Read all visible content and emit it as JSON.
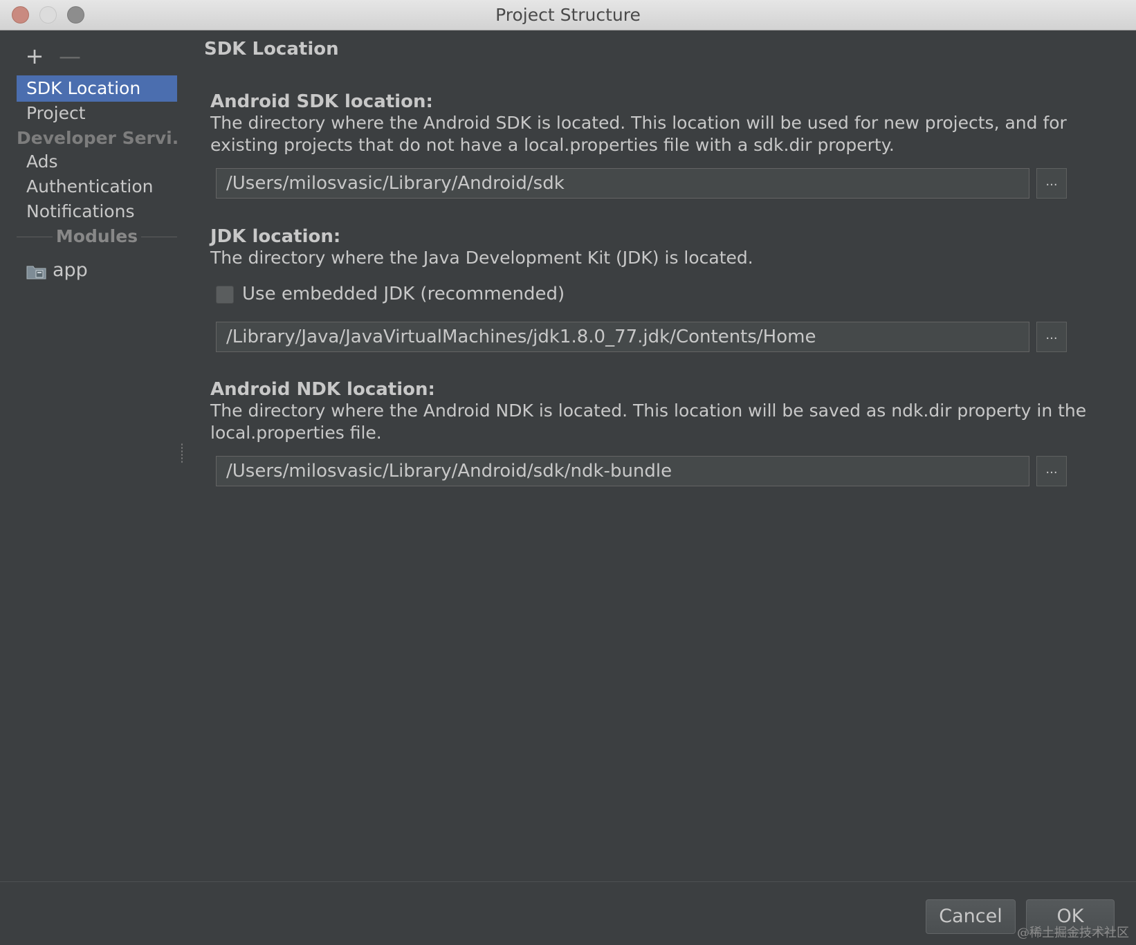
{
  "window": {
    "title": "Project Structure"
  },
  "toolbar": {
    "add_label": "+",
    "remove_label": "—"
  },
  "sidebar": {
    "items": [
      {
        "label": "SDK Location",
        "selected": true
      },
      {
        "label": "Project"
      }
    ],
    "group_label": "Developer Servi...",
    "group_items": [
      {
        "label": "Ads"
      },
      {
        "label": "Authentication"
      },
      {
        "label": "Notifications"
      }
    ],
    "modules_label": "Modules",
    "modules": [
      {
        "label": "app",
        "icon": "module-folder-icon"
      }
    ]
  },
  "panel": {
    "title": "SDK Location",
    "sdk": {
      "title": "Android SDK location:",
      "description": "The directory where the Android SDK is located. This location will be used for new projects, and for existing projects that do not have a local.properties file with a sdk.dir property.",
      "path": "/Users/milosvasic/Library/Android/sdk",
      "browse_label": "..."
    },
    "jdk": {
      "title": "JDK location:",
      "description": "The directory where the Java Development Kit (JDK) is located.",
      "embedded_label": "Use embedded JDK (recommended)",
      "embedded_checked": false,
      "path": "/Library/Java/JavaVirtualMachines/jdk1.8.0_77.jdk/Contents/Home",
      "browse_label": "..."
    },
    "ndk": {
      "title": "Android NDK location:",
      "description": "The directory where the Android NDK is located. This location will be saved as ndk.dir property in the local.properties file.",
      "path": "/Users/milosvasic/Library/Android/sdk/ndk-bundle",
      "browse_label": "..."
    }
  },
  "footer": {
    "cancel_label": "Cancel",
    "ok_label": "OK"
  },
  "watermark": "@稀土掘金技术社区",
  "colors": {
    "background": "#3c3f41",
    "selection": "#4b6eaf",
    "text": "#c8c8c8"
  }
}
